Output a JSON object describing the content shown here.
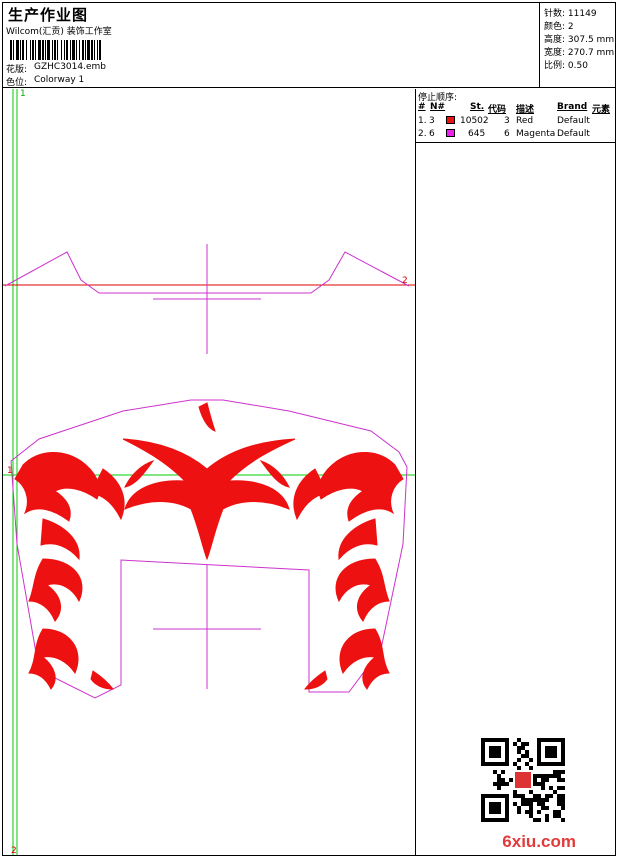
{
  "header": {
    "title": "生产作业图",
    "studio": "Wilcom(汇贡) 装饰工作室",
    "pattern_label": "花版:",
    "pattern_value": "GZHC3014.emb",
    "color_label": "色位:",
    "color_value": "Colorway 1"
  },
  "info": {
    "stitches_label": "针数:",
    "stitches_value": "11149",
    "colors_label": "颜色:",
    "colors_value": "2",
    "height_label": "高度:",
    "height_value": "307.5 mm",
    "width_label": "宽度:",
    "width_value": "270.7 mm",
    "scale_label": "比例:",
    "scale_value": "0.50"
  },
  "stop_sequence": {
    "title": "停止顺序:",
    "headers": {
      "num": "#",
      "needle": "N#",
      "stitches": "St.",
      "code": "代码",
      "desc": "描述",
      "brand": "Brand",
      "element": "元素"
    },
    "rows": [
      {
        "num": "1.",
        "needle": "3",
        "color": "#ee1111",
        "stitches": "10502",
        "code": "3",
        "desc": "Red",
        "brand": "Default"
      },
      {
        "num": "2.",
        "needle": "6",
        "color": "#ee22ee",
        "stitches": "645",
        "code": "6",
        "desc": "Magenta",
        "brand": "Default"
      }
    ]
  },
  "markers": {
    "top_left": "1",
    "bottom_left": "2",
    "right_line": "2",
    "mid_line": "1"
  },
  "watermark": "6xiu.com",
  "colors": {
    "thread_red": "#ee1111",
    "thread_magenta": "#ee22ee",
    "guide_red": "#e00000",
    "guide_green": "#00cc00",
    "outline": "#cc33cc"
  }
}
